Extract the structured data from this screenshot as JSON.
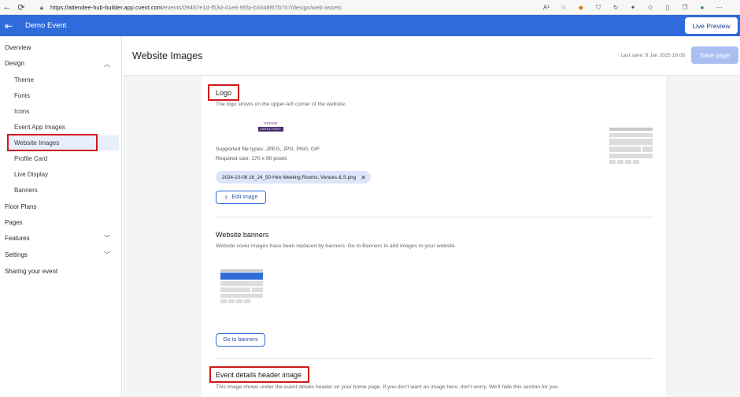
{
  "browser": {
    "back_glyph": "←",
    "refresh_glyph": "⟳",
    "url_host": "https://attendee-hub-builder.app.cvent.com",
    "url_path": "/events/09467e1d-f53d-41e8-95fa-b3348f67b707/design/web-assets",
    "read_aloud": "A¹"
  },
  "header": {
    "event_name": "Demo Event",
    "live_preview": "Live Preview",
    "accent_color": "#2f6bda"
  },
  "sidebar": {
    "items": [
      {
        "label": "Overview"
      },
      {
        "label": "Design"
      },
      {
        "label": "Theme"
      },
      {
        "label": "Fonts"
      },
      {
        "label": "Icons"
      },
      {
        "label": "Event App Images"
      },
      {
        "label": "Website Images"
      },
      {
        "label": "Profile Card"
      },
      {
        "label": "Live Display"
      },
      {
        "label": "Banners"
      },
      {
        "label": "Floor Plans"
      },
      {
        "label": "Pages"
      },
      {
        "label": "Features"
      },
      {
        "label": "Settings"
      },
      {
        "label": "Sharing your event"
      }
    ]
  },
  "main": {
    "title": "Website Images",
    "last_save": "Last save: 8 Jan 2025 16:08",
    "save_label": "Save page",
    "logo": {
      "title": "Logo",
      "description": "The logo shows on the upper-left corner of the website.",
      "logo_text_top": "venue",
      "logo_text_bottom": "DIRECTORY",
      "file_types": "Supported file types: JPEG, JPG, PNG, GIF",
      "required_size": "Required size: 170 x 90 pixels",
      "file_chip": "2024-10-08 16_24_50-Hire Meeting Rooms, Venues & S.png",
      "edit_label": "Edit image"
    },
    "banners": {
      "title": "Website banners",
      "description": "Website cover images have been replaced by banners. Go to Banners to add images to your website.",
      "button_label": "Go to banners"
    },
    "event_header": {
      "title": "Event details header image",
      "description": "This image shows under the event details header on your home page. If you don't want an image here, don't worry. We'll hide this section for you."
    }
  }
}
